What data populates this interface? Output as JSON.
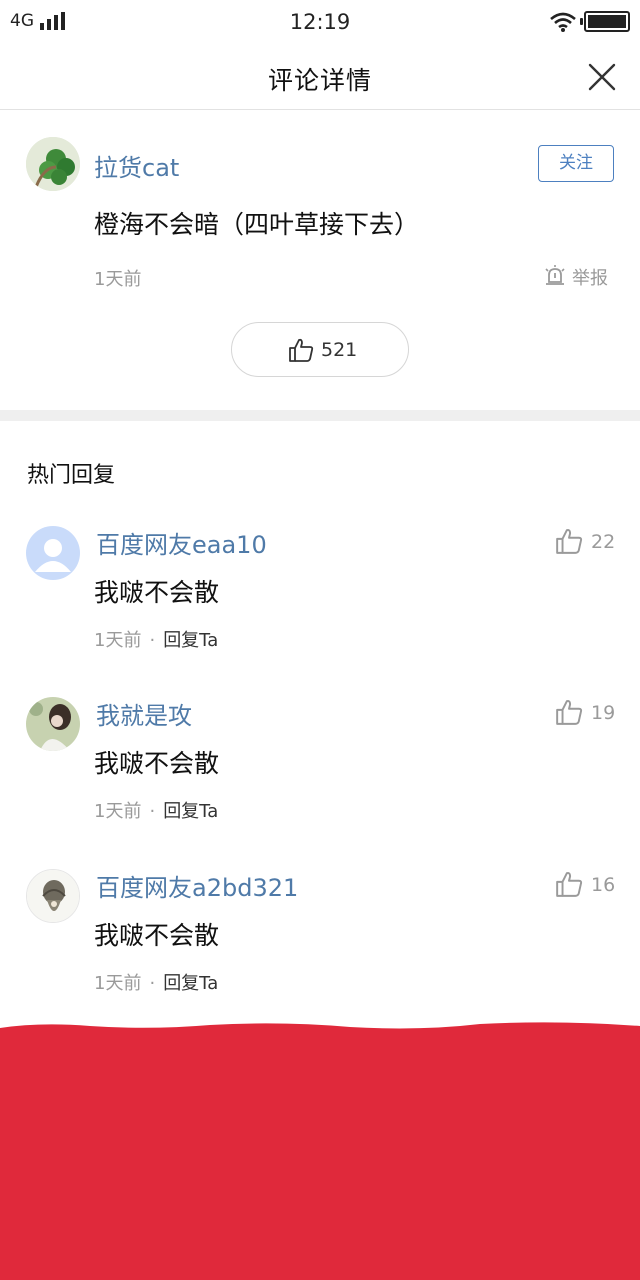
{
  "status_bar": {
    "network": "4G",
    "time": "12:19"
  },
  "nav": {
    "title": "评论详情"
  },
  "main_comment": {
    "username": "拉货cat",
    "follow_label": "关注",
    "content": "橙海不会暗（四叶草接下去）",
    "time": "1天前",
    "report_label": "举报",
    "like_count": "521"
  },
  "hot_replies": {
    "title": "热门回复",
    "items": [
      {
        "username": "百度网友eaa10",
        "content": "我啵不会散",
        "time": "1天前",
        "dot": "·",
        "reply_label": "回复Ta",
        "like_count": "22"
      },
      {
        "username": "我就是攻",
        "content": "我啵不会散",
        "time": "1天前",
        "dot": "·",
        "reply_label": "回复Ta",
        "like_count": "19"
      },
      {
        "username": "百度网友a2bd321",
        "content": "我啵不会散",
        "time": "1天前",
        "dot": "·",
        "reply_label": "回复Ta",
        "like_count": "16"
      }
    ]
  },
  "colors": {
    "link_blue": "#4f7aa8",
    "follow_blue": "#4d80c0",
    "cover_red": "#e0293b"
  },
  "icons": [
    "signal-icon",
    "wifi-icon",
    "battery-icon",
    "close-icon",
    "report-icon",
    "thumbs-up-icon"
  ]
}
